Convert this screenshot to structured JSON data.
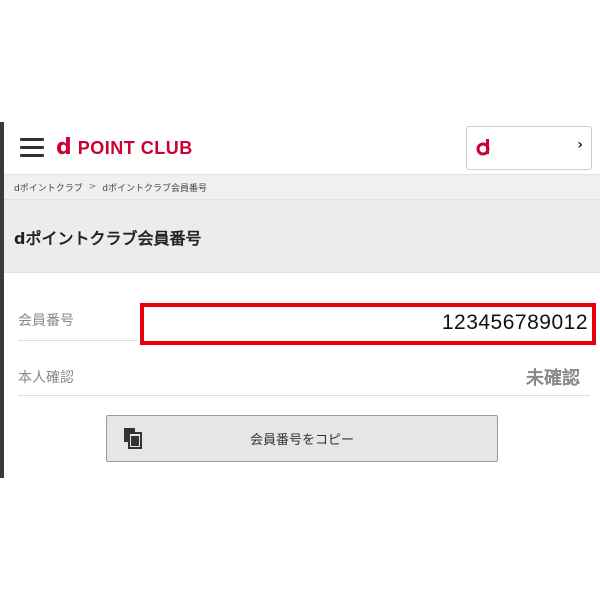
{
  "header": {
    "logo_letter": "d",
    "logo_text": "POINT CLUB",
    "account_icon_letter": "d",
    "account_chevron": "›",
    "brand_color": "#cc0033"
  },
  "breadcrumb": {
    "items": [
      "dポイントクラブ",
      "dポイントクラブ会員番号"
    ],
    "separator": ">"
  },
  "page": {
    "title": "dポイントクラブ会員番号"
  },
  "member": {
    "number_label": "会員番号",
    "number_value": "123456789012",
    "verify_label": "本人確認",
    "verify_value": "未確認",
    "highlight_color": "#e8000a"
  },
  "actions": {
    "copy_label": "会員番号をコピー",
    "copy_icon": "copy-document-icon"
  }
}
